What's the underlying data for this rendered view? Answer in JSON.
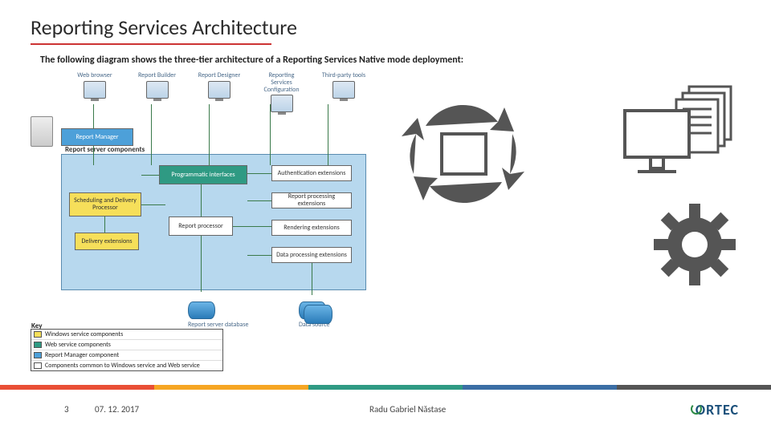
{
  "title": "Reporting Services Architecture",
  "subtitle": "The following diagram shows the three-tier architecture of a Reporting Services Native mode deployment:",
  "clients": [
    {
      "label": "Web browser"
    },
    {
      "label": "Report Builder"
    },
    {
      "label": "Report Designer"
    },
    {
      "label": "Reporting Services Configuration"
    },
    {
      "label": "Third-party tools"
    }
  ],
  "boxes": {
    "report_manager": "Report Manager",
    "panel_title": "Report server components",
    "programmatic_interfaces": "Programmatic interfaces",
    "scheduling_delivery": "Scheduling and Delivery Processor",
    "report_processor": "Report processor",
    "delivery_ext": "Delivery extensions",
    "auth_ext": "Authentication extensions",
    "report_proc_ext": "Report processing extensions",
    "rendering_ext": "Rendering extensions",
    "data_proc_ext": "Data processing extensions"
  },
  "datasources": {
    "db": "Report server database",
    "ds": "Data source"
  },
  "key": {
    "title": "Key",
    "items": [
      {
        "color": "#f6df5a",
        "label": "Windows service components"
      },
      {
        "color": "#2f9a83",
        "label": "Web service components"
      },
      {
        "color": "#4da0d9",
        "label": "Report Manager component"
      },
      {
        "color": "#ffffff",
        "label": "Components common to Windows service and Web service"
      }
    ]
  },
  "footer": {
    "page": "3",
    "date": "07. 12. 2017",
    "author": "Radu Gabriel Năstase",
    "logo": "ORTEC"
  }
}
